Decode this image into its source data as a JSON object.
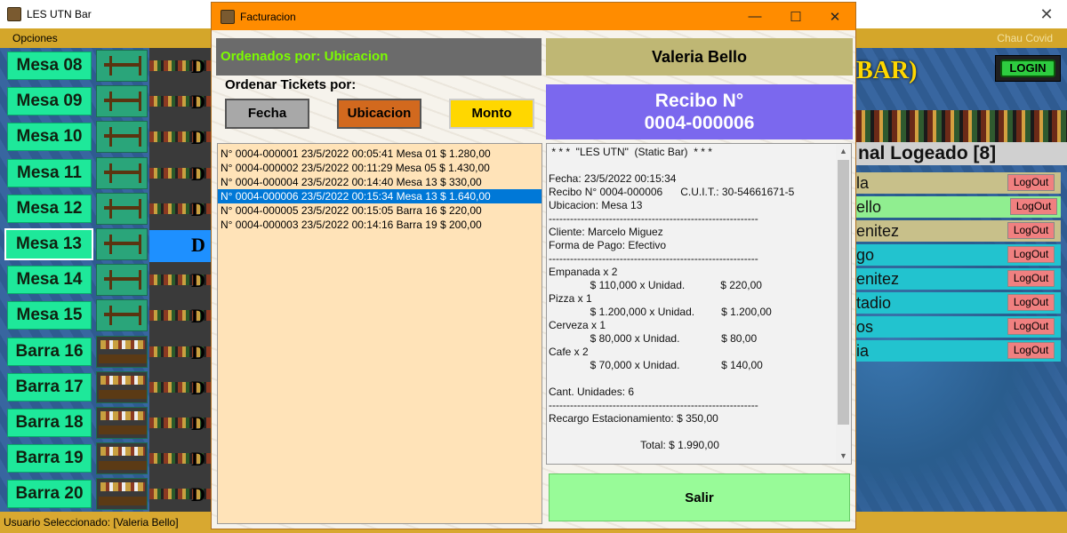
{
  "main_window": {
    "title": "LES UTN Bar",
    "close_glyph": "✕",
    "menu_options": "Opciones",
    "menu_right": "Chau Covid",
    "status_text": "Usuario Seleccionado: [Valeria Bello]",
    "banner_text": "BAR)",
    "login_label": "LOGIN",
    "personal_title": "nal Logeado [8]",
    "tables": [
      "Mesa 08",
      "Mesa 09",
      "Mesa 10",
      "Mesa 11",
      "Mesa 12",
      "Mesa 13",
      "Mesa 14",
      "Mesa 15",
      "Barra 16",
      "Barra 17",
      "Barra 18",
      "Barra 19",
      "Barra 20"
    ],
    "table_letter": "D",
    "users": [
      {
        "name": "la",
        "logout": "LogOut"
      },
      {
        "name": "ello",
        "logout": "LogOut"
      },
      {
        "name": "enitez",
        "logout": "LogOut"
      },
      {
        "name": "go",
        "logout": "LogOut"
      },
      {
        "name": "enitez",
        "logout": "LogOut"
      },
      {
        "name": "tadio",
        "logout": "LogOut"
      },
      {
        "name": "os",
        "logout": "LogOut"
      },
      {
        "name": "ia",
        "logout": "LogOut"
      }
    ]
  },
  "dialog": {
    "title": "Facturacion",
    "minimize_glyph": "—",
    "maximize_glyph": "☐",
    "close_glyph": "✕",
    "order_label": "Ordenados por: Ubicacion",
    "order_tickets_label": "Ordenar Tickets por:",
    "sort_buttons": {
      "fecha": "Fecha",
      "ubicacion": "Ubicacion",
      "monto": "Monto"
    },
    "tickets": [
      "N° 0004-000001 23/5/2022 00:05:41 Mesa 01 $ 1.280,00",
      "N° 0004-000002 23/5/2022 00:11:29 Mesa 05 $ 1.430,00",
      "N° 0004-000004 23/5/2022 00:14:40 Mesa 13 $ 330,00",
      "N° 0004-000006 23/5/2022 00:15:34 Mesa 13 $ 1.640,00",
      "N° 0004-000005 23/5/2022 00:15:05 Barra 16 $ 220,00",
      "N° 0004-000003 23/5/2022 00:14:16 Barra 19 $ 200,00"
    ],
    "selected_ticket_index": 3,
    "client_name": "Valeria Bello",
    "recibo_title": "Recibo N°",
    "recibo_number": "0004-000006",
    "receipt_text": " * * *  \"LES UTN\"  (Static Bar)  * * *\n\nFecha: 23/5/2022 00:15:34\nRecibo N° 0004-000006      C.U.I.T.: 30-54661671-5\nUbicacion: Mesa 13\n-----------------------------------------------------------\nCliente: Marcelo Miguez\nForma de Pago: Efectivo\n-----------------------------------------------------------\nEmpanada x 2\n              $ 110,000 x Unidad.            $ 220,00\nPizza x 1\n              $ 1.200,000 x Unidad.         $ 1.200,00\nCerveza x 1\n              $ 80,000 x Unidad.              $ 80,00\nCafe x 2\n              $ 70,000 x Unidad.              $ 140,00\n\nCant. Unidades: 6\n-----------------------------------------------------------\nRecargo Estacionamiento: $ 350,00\n\n                               Total: $ 1.990,00",
    "scroll_up_glyph": "▲",
    "scroll_down_glyph": "▼",
    "salir_label": "Salir"
  }
}
